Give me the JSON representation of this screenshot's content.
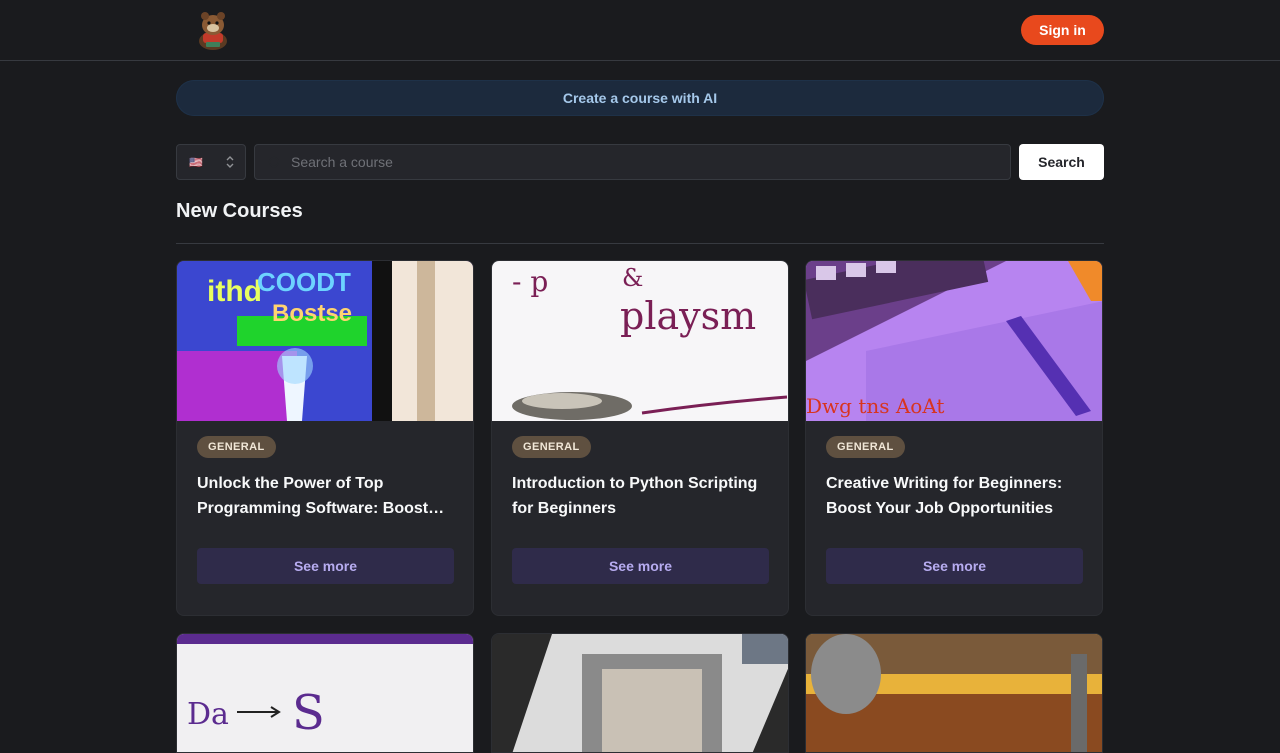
{
  "header": {
    "logo_alt": "logo",
    "signin_label": "Sign in"
  },
  "ai": {
    "create_label": "Create a course with AI"
  },
  "filters": {
    "language_value": "🇺🇸",
    "search_placeholder": "Search a course",
    "search_label": "Search"
  },
  "section": {
    "title": "New Courses"
  },
  "courses": [
    {
      "category": "GENERAL",
      "title": "Unlock the Power of Top Programming Software: Boost Your Productivity",
      "button": "See more"
    },
    {
      "category": "GENERAL",
      "title": "Introduction to Python Scripting for Beginners",
      "button": "See more"
    },
    {
      "category": "GENERAL",
      "title": "Creative Writing for Beginners: Boost Your Job Opportunities",
      "button": "See more"
    }
  ],
  "colors": {
    "background": "#1a1b1e",
    "card": "#25262b",
    "signin": "#e8491d",
    "badge": "#5f5040",
    "see_more": "#2f2b4a"
  }
}
